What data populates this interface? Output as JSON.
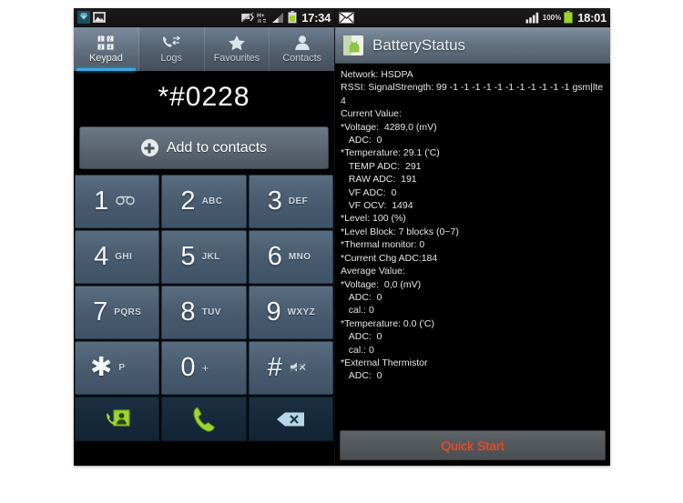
{
  "left_phone": {
    "statusbar": {
      "icons_left": [
        "wifi-download-icon",
        "screenshot-icon"
      ],
      "icons_right": [
        "nfc-off-icon",
        "hsdpa-icon",
        "signal-icon",
        "battery-icon"
      ],
      "clock": "17:34"
    },
    "tabs": [
      {
        "label": "Keypad",
        "icon": "keypad-icon",
        "active": true
      },
      {
        "label": "Logs",
        "icon": "call-log-icon",
        "active": false
      },
      {
        "label": "Favourites",
        "icon": "star-icon",
        "active": false
      },
      {
        "label": "Contacts",
        "icon": "person-icon",
        "active": false
      }
    ],
    "dialer": {
      "number": "*#0228",
      "add_to_contacts_label": "Add to contacts",
      "add_icon": "plus-circle-icon"
    },
    "keys": [
      {
        "digit": "1",
        "sub": "∞",
        "sub_kind": "voicemail"
      },
      {
        "digit": "2",
        "sub": "ABC",
        "sub_kind": "letters"
      },
      {
        "digit": "3",
        "sub": "DEF",
        "sub_kind": "letters"
      },
      {
        "digit": "4",
        "sub": "GHI",
        "sub_kind": "letters"
      },
      {
        "digit": "5",
        "sub": "JKL",
        "sub_kind": "letters"
      },
      {
        "digit": "6",
        "sub": "MNO",
        "sub_kind": "letters"
      },
      {
        "digit": "7",
        "sub": "PQRS",
        "sub_kind": "letters"
      },
      {
        "digit": "8",
        "sub": "TUV",
        "sub_kind": "letters"
      },
      {
        "digit": "9",
        "sub": "WXYZ",
        "sub_kind": "letters"
      },
      {
        "digit": "✱",
        "sub": "P",
        "sub_kind": "letters"
      },
      {
        "digit": "0",
        "sub": "+",
        "sub_kind": "symbol"
      },
      {
        "digit": "#",
        "sub": "⌧",
        "sub_kind": "mute"
      }
    ],
    "actions": [
      {
        "name": "video-call-button",
        "icon": "contact-call-icon"
      },
      {
        "name": "call-button",
        "icon": "phone-handset-icon"
      },
      {
        "name": "backspace-button",
        "icon": "backspace-icon"
      }
    ]
  },
  "right_phone": {
    "statusbar": {
      "icons_left": [
        "message-icon"
      ],
      "icons_right": [
        "signal-icon",
        "battery-icon"
      ],
      "battery_percent": "100%",
      "clock": "18:01"
    },
    "app": {
      "title": "BatteryStatus",
      "icon": "android-app-icon"
    },
    "readout": "Network: HSDPA\nRSSI: SignalStrength: 99 -1 -1 -1 -1 -1 -1 -1 -1 -1 -1 -1 gsm|lte 4",
    "readout_current_header": "Current Value:",
    "readout_current": "*Voltage:  4289,0 (mV)\n   ADC:  0\n*Temperature: 29.1 ('C)\n   TEMP ADC:  291\n   RAW ADC:  191\n   VF ADC:  0\n   VF OCV:  1494\n*Level: 100 (%)\n*Level Block: 7 blocks (0~7)\n*Thermal monitor: 0\n*Current Chg ADC:184",
    "readout_average_header": "Average Value:",
    "readout_average": "*Voltage:  0,0 (mV)\n   ADC:  0\n   cal.: 0\n*Temperature: 0.0 ('C)\n   ADC:  0\n   cal.: 0\n*External Thermistor\n   ADC:  0",
    "quick_start_label": "Quick Start"
  },
  "colors": {
    "accent_tab": "#3ba7e0",
    "key_face": "#4a5d70",
    "call_green": "#8dd63f",
    "backspace_blue": "#b9d6e8",
    "quick_start_text": "#e8502a",
    "battery_green": "#8dd63f"
  }
}
